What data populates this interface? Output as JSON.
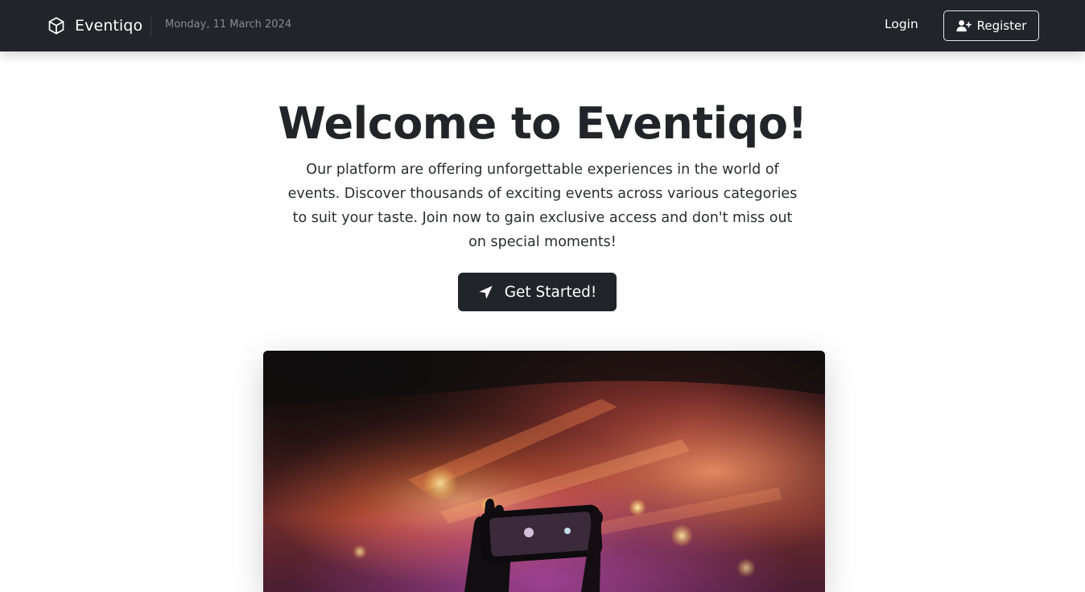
{
  "navbar": {
    "brand_name": "Eventiqo",
    "brand_icon": "cube-icon",
    "date": "Monday, 11 March 2024",
    "login_label": "Login",
    "register_label": "Register",
    "register_icon": "user-plus-icon"
  },
  "hero": {
    "title": "Welcome to Eventiqo!",
    "description": "Our platform are offering unforgettable experiences in the world of events. Discover thousands of exciting events across various categories to suit your taste. Join now to gain exclusive access and don't miss out on special moments!",
    "cta_label": "Get Started!",
    "cta_icon": "location-arrow-icon",
    "image": "concert-crowd-phone-photo"
  },
  "colors": {
    "navbar_bg": "#212429",
    "button_dark": "#212429",
    "text_dark": "#232427",
    "muted_text": "#868c94",
    "white": "#ffffff"
  }
}
